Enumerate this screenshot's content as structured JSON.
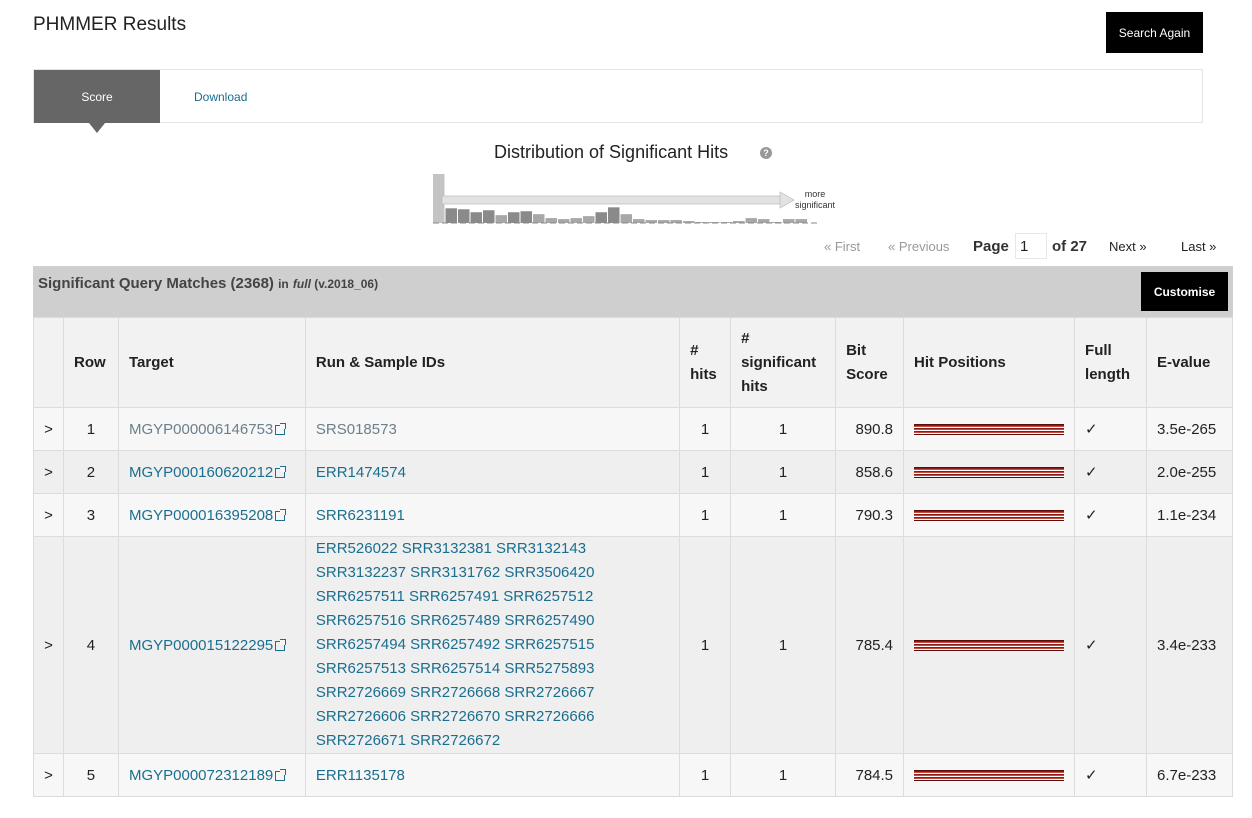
{
  "page": {
    "title": "PHMMER Results",
    "search_again": "Search Again"
  },
  "tabs": {
    "score": "Score",
    "download": "Download"
  },
  "distribution": {
    "title": "Distribution of Significant Hits",
    "help": "?",
    "arrow_label_1": "more",
    "arrow_label_2": "significant",
    "bins": [
      1.0,
      0.3,
      0.28,
      0.22,
      0.26,
      0.16,
      0.22,
      0.24,
      0.18,
      0.1,
      0.08,
      0.1,
      0.14,
      0.22,
      0.32,
      0.18,
      0.08,
      0.06,
      0.06,
      0.06,
      0.04,
      0.02,
      0.02,
      0.02,
      0.04,
      0.1,
      0.08,
      0.02,
      0.08,
      0.08
    ]
  },
  "pager": {
    "first": "« First",
    "previous": "« Previous",
    "page_label": "Page",
    "page_value": "1",
    "of_label": "of 27",
    "next": "Next »",
    "last": "Last »"
  },
  "results": {
    "title": "Significant Query Matches (2368)",
    "in_label": "in",
    "db_name": "full",
    "db_version": "(v.2018_06)",
    "customise": "Customise",
    "columns": [
      "Row",
      "Target",
      "Run & Sample IDs",
      "#",
      "hits",
      "#",
      "significant",
      "hits",
      "Bit",
      "Score",
      "Hit Positions",
      "Full",
      "length",
      "E-value"
    ],
    "rows": [
      {
        "expand": ">",
        "row": "1",
        "target": "MGYP000006146753",
        "runs": "SRS018573",
        "hits": "1",
        "sig_hits": "1",
        "bit_score": "890.8",
        "full": "✓",
        "evalue": "3.5e-265"
      },
      {
        "expand": ">",
        "row": "2",
        "target": "MGYP000160620212",
        "runs": "ERR1474574",
        "hits": "1",
        "sig_hits": "1",
        "bit_score": "858.6",
        "full": "✓",
        "evalue": "2.0e-255"
      },
      {
        "expand": ">",
        "row": "3",
        "target": "MGYP000016395208",
        "runs": "SRR6231191",
        "hits": "1",
        "sig_hits": "1",
        "bit_score": "790.3",
        "full": "✓",
        "evalue": "1.1e-234"
      },
      {
        "expand": ">",
        "row": "4",
        "target": "MGYP000015122295",
        "run_lines": [
          "ERR526022 SRR3132381 SRR3132143",
          "SRR3132237 SRR3131762 SRR3506420",
          "SRR6257511 SRR6257491 SRR6257512",
          "SRR6257516 SRR6257489 SRR6257490",
          "SRR6257494 SRR6257492 SRR6257515",
          "SRR6257513 SRR6257514 SRR5275893",
          "SRR2726669 SRR2726668 SRR2726667",
          "SRR2726606 SRR2726670 SRR2726666",
          "SRR2726671 SRR2726672"
        ],
        "hits": "1",
        "sig_hits": "1",
        "bit_score": "785.4",
        "full": "✓",
        "evalue": "3.4e-233"
      },
      {
        "expand": ">",
        "row": "5",
        "target": "MGYP000072312189",
        "runs": "ERR1135178",
        "hits": "1",
        "sig_hits": "1",
        "bit_score": "784.5",
        "full": "✓",
        "evalue": "6.7e-233"
      }
    ]
  }
}
